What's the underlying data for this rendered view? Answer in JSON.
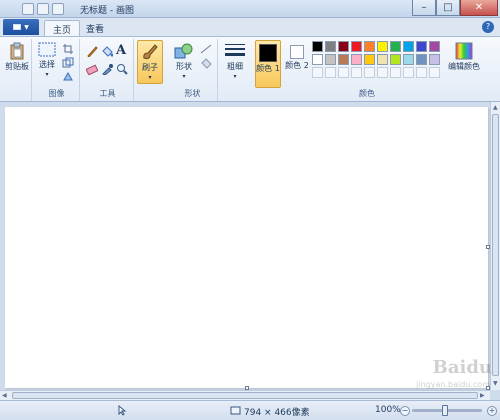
{
  "window": {
    "title": "无标题 - 画图",
    "minimize_glyph": "–",
    "maximize_glyph": "□",
    "close_glyph": "✕"
  },
  "tabs": [
    {
      "label": "主页",
      "active": true
    },
    {
      "label": "查看",
      "active": false
    }
  ],
  "help_glyph": "?",
  "ribbon": {
    "clipboard": {
      "paste_label": "剪贴板",
      "group": ""
    },
    "image": {
      "select_label": "选择",
      "group": "图像"
    },
    "tools": {
      "group": "工具",
      "text_tool_glyph": "A"
    },
    "brushes": {
      "label": "刷子"
    },
    "shapes": {
      "label": "形状",
      "group": "形状"
    },
    "size": {
      "label": "粗细"
    },
    "color1": {
      "label": "颜色 1",
      "value": "#000000"
    },
    "color2": {
      "label": "颜色 2",
      "value": "#ffffff"
    },
    "edit_colors": {
      "label": "编辑颜色"
    },
    "colors_group": "颜色",
    "palette_row1": [
      "#000000",
      "#7f7f7f",
      "#880015",
      "#ed1c24",
      "#ff7f27",
      "#fff200",
      "#22b14c",
      "#00a2e8",
      "#3f48cc",
      "#a349a4"
    ],
    "palette_row2": [
      "#ffffff",
      "#c3c3c3",
      "#b97a57",
      "#ffaec9",
      "#ffc90e",
      "#efe4b0",
      "#b5e61d",
      "#99d9ea",
      "#7092be",
      "#c8bfe7"
    ],
    "palette_row3_count": 10
  },
  "status": {
    "dimensions": "794 × 466像素",
    "zoom": "100%",
    "zoom_minus": "−",
    "zoom_plus": "+"
  },
  "watermark": {
    "text": "Baidu",
    "sub": "jingyan.baidu.com"
  }
}
